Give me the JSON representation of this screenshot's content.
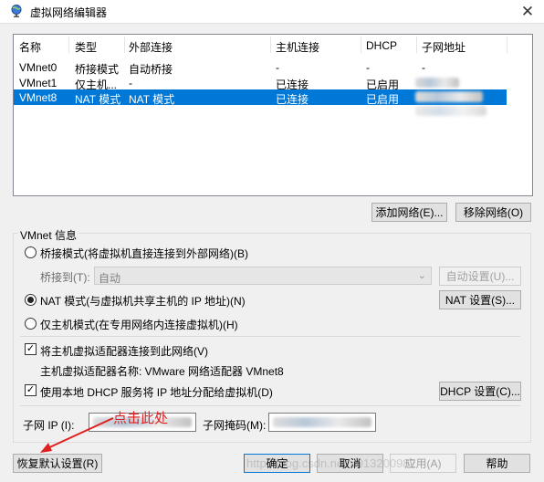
{
  "window": {
    "title": "虚拟网络编辑器",
    "close_glyph": "✕"
  },
  "table": {
    "headers": [
      "名称",
      "类型",
      "外部连接",
      "主机连接",
      "DHCP",
      "子网地址"
    ],
    "rows": [
      {
        "name": "VMnet0",
        "type": "桥接模式",
        "external": "自动桥接",
        "host": "-",
        "dhcp": "-",
        "subnet": "-"
      },
      {
        "name": "VMnet1",
        "type": "仅主机...",
        "external": "-",
        "host": "已连接",
        "dhcp": "已启用",
        "subnet": ""
      },
      {
        "name": "VMnet8",
        "type": "NAT 模式",
        "external": "NAT 模式",
        "host": "已连接",
        "dhcp": "已启用",
        "subnet": ""
      }
    ]
  },
  "buttons": {
    "add_network": "添加网络(E)...",
    "remove_network": "移除网络(O)",
    "auto_settings": "自动设置(U)...",
    "nat_settings": "NAT 设置(S)...",
    "dhcp_settings": "DHCP 设置(C)...",
    "restore_defaults": "恢复默认设置(R)",
    "ok": "确定",
    "cancel": "取消",
    "apply": "应用(A)",
    "help": "帮助"
  },
  "vmnet_info": {
    "group_title": "VMnet 信息",
    "bridged_label": "桥接模式(将虚拟机直接连接到外部网络)(B)",
    "bridged_to_label": "桥接到(T):",
    "bridged_to_value": "自动",
    "nat_label": "NAT 模式(与虚拟机共享主机的 IP 地址)(N)",
    "hostonly_label": "仅主机模式(在专用网络内连接虚拟机)(H)",
    "connect_adapter_label": "将主机虚拟适配器连接到此网络(V)",
    "adapter_name_label": "主机虚拟适配器名称: VMware 网络适配器 VMnet8",
    "use_dhcp_label": "使用本地 DHCP 服务将 IP 地址分配给虚拟机(D)",
    "subnet_ip_label": "子网 IP (I):",
    "subnet_mask_label": "子网掩码(M):"
  },
  "annotation": "点击此处",
  "watermark": "http://blog.csdn.net/u013200982"
}
